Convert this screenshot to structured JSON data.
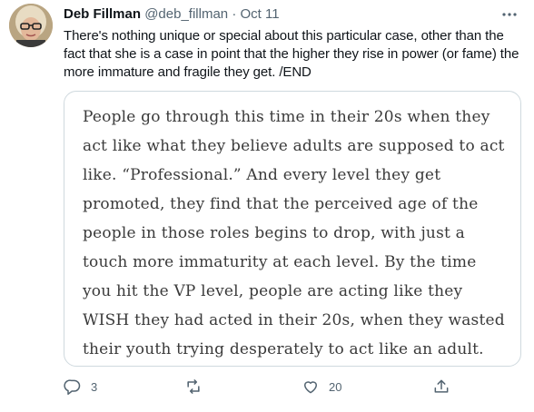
{
  "tweet": {
    "display_name": "Deb Fillman",
    "handle": "@deb_fillman",
    "separator": "·",
    "date": "Oct 11",
    "text": "There's nothing unique or special about this particular case, other than the fact that she is a case in point that the higher they rise in power (or fame) the more immature and fragile they get. /END",
    "quote_text": "People go through this time in their 20s when they act like what they believe adults are supposed to act like. “Professional.” And every level they get promoted, they find that the perceived age of the people in those roles begins to drop, with just a touch more immaturity at each level. By the time you hit the VP level, people are acting like they WISH they had acted in their 20s, when they wasted their youth trying desperately to act like an adult."
  },
  "actions": {
    "reply_count": "3",
    "retweet_count": "",
    "like_count": "20"
  },
  "icons": {
    "more": "more-icon",
    "reply": "reply-icon",
    "retweet": "retweet-icon",
    "like": "heart-icon",
    "share": "share-icon"
  },
  "colors": {
    "text": "#0f1419",
    "secondary": "#536471",
    "border": "#cfd9de"
  }
}
